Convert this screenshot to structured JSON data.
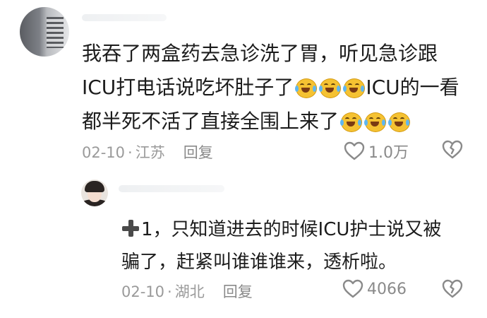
{
  "comment": {
    "text_before_emoji": "我吞了两盒药去急诊洗了胃，听见急诊跟ICU打电话说吃坏肚子了",
    "text_middle": "ICU的一看都半死不活了直接全围上来了",
    "date": "02-10",
    "location": "江苏",
    "reply_label": "回复",
    "like_count": "1.0万"
  },
  "reply": {
    "text": "1，只知道进去的时候ICU护士说又被骗了，赶紧叫谁谁谁来，透析啦。",
    "date": "02-10",
    "location": "湖北",
    "reply_label": "回复",
    "like_count": "4066"
  },
  "separator": "·",
  "icons": {
    "emoji": "crying-laughing-emoji",
    "plus": "plus-icon",
    "like": "heart-icon",
    "dislike": "broken-heart-icon"
  },
  "colors": {
    "meta_text": "#9a9a9a",
    "body_text": "#1c1c1c",
    "emoji_yellow": "#f5c232"
  }
}
